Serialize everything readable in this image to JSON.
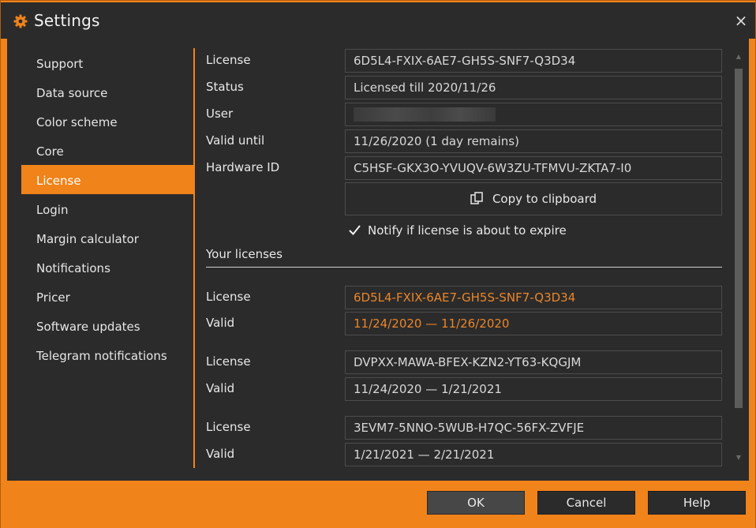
{
  "window": {
    "title": "Settings",
    "title_icon": "gear-icon",
    "close_glyph": "×"
  },
  "sidebar": {
    "items": [
      {
        "label": "Support"
      },
      {
        "label": "Data source"
      },
      {
        "label": "Color scheme"
      },
      {
        "label": "Core"
      },
      {
        "label": "License",
        "active": true
      },
      {
        "label": "Login"
      },
      {
        "label": "Margin calculator"
      },
      {
        "label": "Notifications"
      },
      {
        "label": "Pricer"
      },
      {
        "label": "Software updates"
      },
      {
        "label": "Telegram notifications"
      }
    ]
  },
  "license_info": {
    "license_label": "License",
    "license_value": "6D5L4-FXIX-6AE7-GH5S-SNF7-Q3D34",
    "status_label": "Status",
    "status_value": "Licensed till 2020/11/26",
    "user_label": "User",
    "user_value": "",
    "valid_until_label": "Valid until",
    "valid_until_value": "11/26/2020 (1 day remains)",
    "hardware_id_label": "Hardware ID",
    "hardware_id_value": "C5HSF-GKX3O-YVUQV-6W3ZU-TFMVU-ZKTA7-I0",
    "copy_button_label": "Copy to clipboard",
    "notify_label": "Notify if license is about to expire",
    "notify_checked": true
  },
  "your_licenses": {
    "title": "Your licenses",
    "license_label": "License",
    "valid_label": "Valid",
    "items": [
      {
        "license": "6D5L4-FXIX-6AE7-GH5S-SNF7-Q3D34",
        "valid": "11/24/2020 — 11/26/2020",
        "current": true
      },
      {
        "license": "DVPXX-MAWA-BFEX-KZN2-YT63-KQGJM",
        "valid": "11/24/2020 — 1/21/2021",
        "current": false
      },
      {
        "license": "3EVM7-5NNO-5WUB-H7QC-56FX-ZVFJE",
        "valid": "1/21/2021 — 2/21/2021",
        "current": false
      }
    ]
  },
  "footer": {
    "ok_label": "OK",
    "cancel_label": "Cancel",
    "help_label": "Help"
  },
  "colors": {
    "accent": "#f0831a",
    "background": "#2b2b2b",
    "highlight_text": "#e9862a"
  }
}
